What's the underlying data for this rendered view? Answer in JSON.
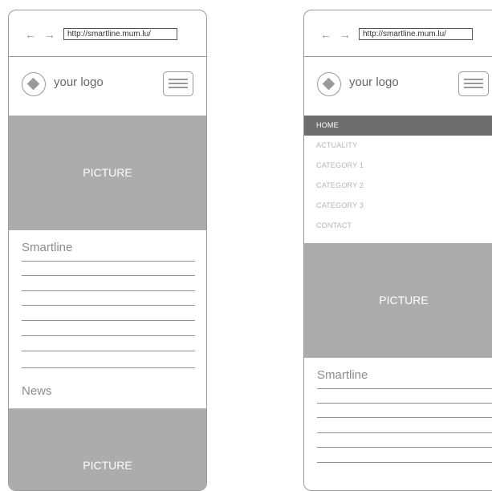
{
  "browser": {
    "nav_arrows": "← →",
    "url": "http://smartline.mum.lu/"
  },
  "header": {
    "logo_text": "your logo"
  },
  "picture_label": "PICTURE",
  "sections": {
    "smartline": "Smartline",
    "news": "News"
  },
  "menu": {
    "items": [
      "HOME",
      "ACTUALITY",
      "CATEGORY 1",
      "CATEGORY 2",
      "CATEGORY 3",
      "CONTACT"
    ],
    "active_index": 0
  },
  "colors": {
    "picture_bg": "#acacac",
    "menu_active_bg": "#6d6d6d",
    "border": "#9a9a9a"
  }
}
